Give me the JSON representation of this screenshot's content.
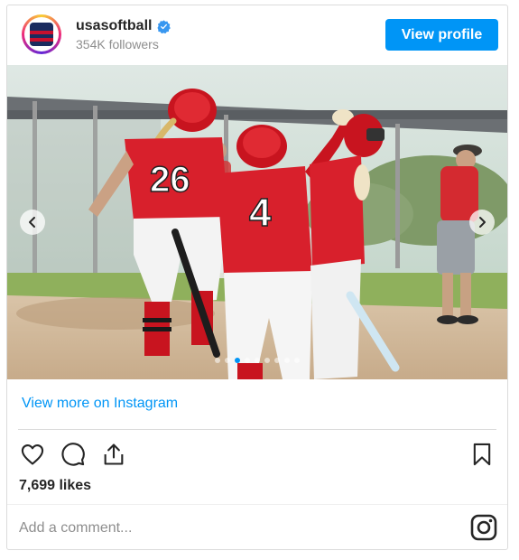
{
  "header": {
    "username": "usasoftball",
    "followers": "354K followers",
    "view_profile_label": "View profile"
  },
  "media": {
    "slide_count": 9,
    "active_slide": 2,
    "jersey_numbers": [
      "26",
      "4"
    ]
  },
  "footer": {
    "view_more_label": "View more on Instagram",
    "likes": "7,699 likes",
    "comment_placeholder": "Add a comment..."
  },
  "colors": {
    "accent": "#0095f6",
    "jersey_red": "#d8202c",
    "text": "#262626",
    "muted": "#8e8e8e"
  },
  "icons": [
    "verified-icon",
    "chevron-left-icon",
    "chevron-right-icon",
    "heart-icon",
    "comment-icon",
    "share-icon",
    "bookmark-icon",
    "instagram-icon"
  ]
}
